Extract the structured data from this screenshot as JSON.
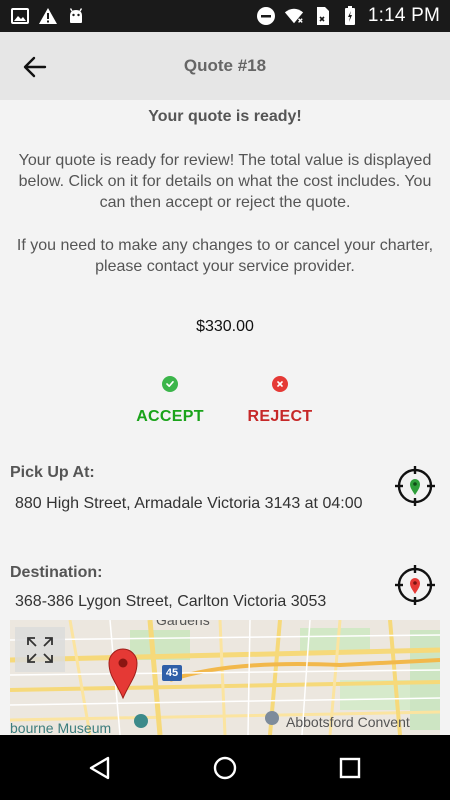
{
  "status_bar": {
    "time": "1:14 PM",
    "icons": [
      "image-icon",
      "alert-icon",
      "android-icon",
      "do-not-disturb-icon",
      "wifi-icon",
      "sim-icon",
      "battery-icon"
    ]
  },
  "header": {
    "title": "Quote #18",
    "back_icon": "arrow-left-icon"
  },
  "main": {
    "heading": "Your quote is ready!",
    "paragraph_1": "Your quote is ready for review! The total value is displayed below. Click on it for details on what the cost includes. You can then accept or reject the quote.",
    "paragraph_2": "If you need to make any changes to or cancel your charter, please contact your service provider.",
    "amount": "$330.00",
    "accept_label": "ACCEPT",
    "reject_label": "REJECT",
    "pickup": {
      "label": "Pick Up At:",
      "value": "880 High Street, Armadale Victoria 3143 at 04:00"
    },
    "destination": {
      "label": "Destination:",
      "value": "368-386 Lygon Street, Carlton Victoria 3053"
    }
  },
  "map": {
    "labels": {
      "museum": "bourne Museum",
      "convent": "Abbotsford Convent",
      "gardens": "Gardens",
      "freeway": "45"
    }
  },
  "colors": {
    "accept": "#1aa31a",
    "reject": "#c62828",
    "pickup_pin": "#2e9e3a",
    "destination_pin": "#e53935",
    "map_pin": "#e53935"
  },
  "nav_bar": {
    "icons": [
      "back-triangle-icon",
      "home-circle-icon",
      "recents-square-icon"
    ]
  }
}
